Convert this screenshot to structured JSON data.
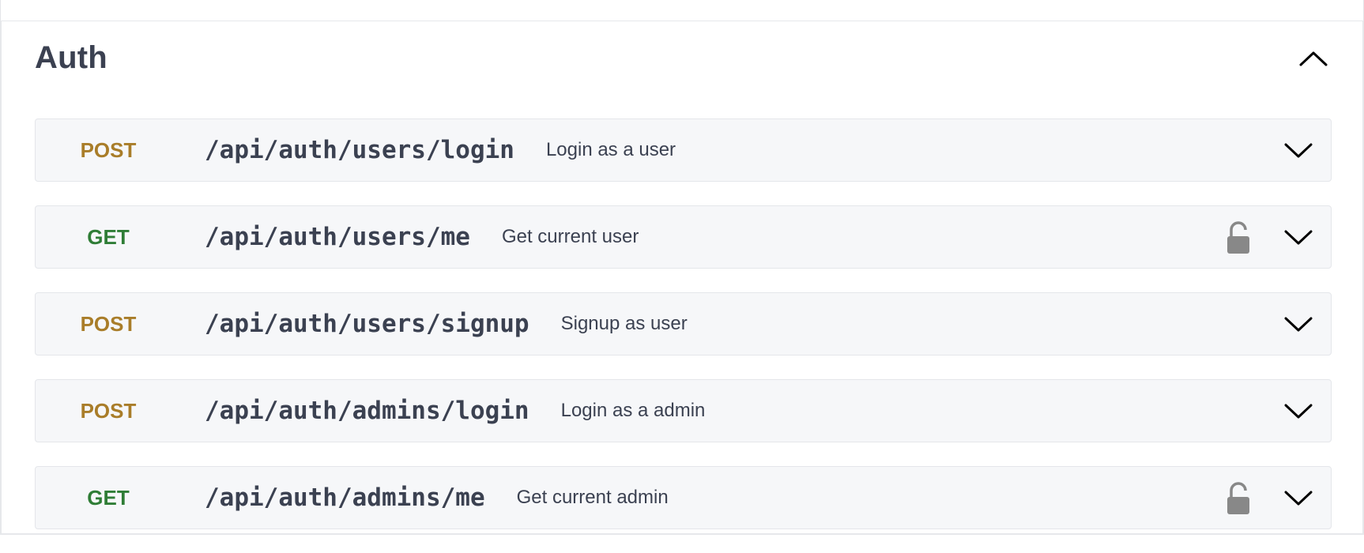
{
  "section": {
    "title": "Auth",
    "collapse_icon": "chevron-up-icon"
  },
  "operations": [
    {
      "method": "POST",
      "path": "/api/auth/users/login",
      "summary": "Login as a user",
      "locked": false
    },
    {
      "method": "GET",
      "path": "/api/auth/users/me",
      "summary": "Get current user",
      "locked": true
    },
    {
      "method": "POST",
      "path": "/api/auth/users/signup",
      "summary": "Signup as user",
      "locked": false
    },
    {
      "method": "POST",
      "path": "/api/auth/admins/login",
      "summary": "Login as a admin",
      "locked": false
    },
    {
      "method": "GET",
      "path": "/api/auth/admins/me",
      "summary": "Get current admin",
      "locked": true
    }
  ],
  "colors": {
    "post": "#a97d29",
    "get": "#2f7d36",
    "lock": "#888888"
  }
}
